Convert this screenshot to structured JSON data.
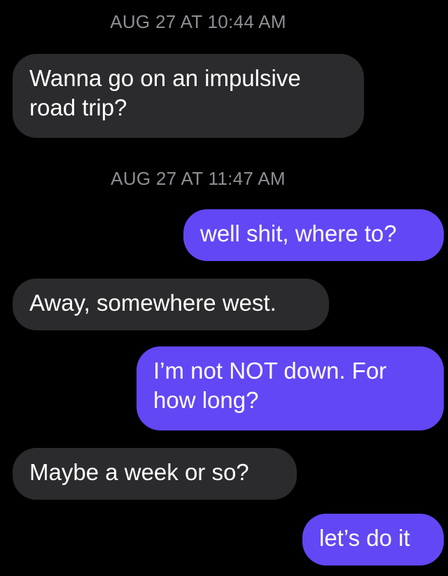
{
  "conversation": {
    "timestamps": [
      "AUG 27 AT 10:44 AM",
      "AUG 27 AT 11:47 AM"
    ],
    "messages": [
      {
        "sender": "them",
        "text": "Wanna go on an impulsive road trip?"
      },
      {
        "sender": "me",
        "text": "well shit, where to?"
      },
      {
        "sender": "them",
        "text": "Away, somewhere west."
      },
      {
        "sender": "me",
        "text": "I’m not NOT down. For how long?"
      },
      {
        "sender": "them",
        "text": "Maybe a week or so?"
      },
      {
        "sender": "me",
        "text": "let’s do it"
      }
    ]
  },
  "colors": {
    "background": "#000000",
    "incoming_bubble": "#2b2b2d",
    "outgoing_bubble": "#6247f5",
    "timestamp_text": "#8e8e93"
  }
}
